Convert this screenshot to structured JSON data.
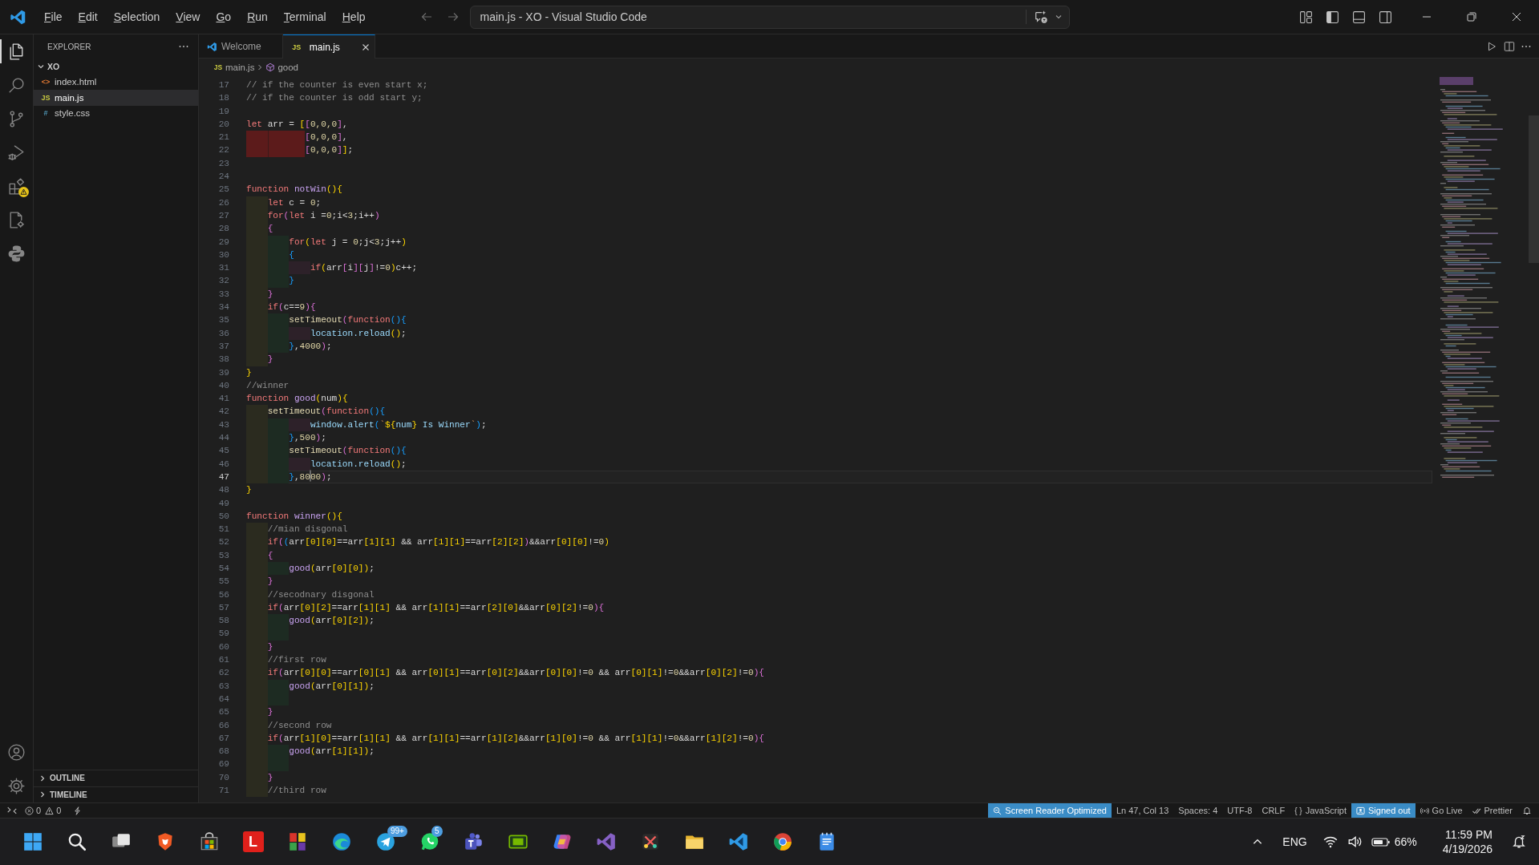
{
  "title_bar": {
    "menu": [
      "File",
      "Edit",
      "Selection",
      "View",
      "Go",
      "Run",
      "Terminal",
      "Help"
    ],
    "command_center": "main.js - XO - Visual Studio Code"
  },
  "activity_bar": {
    "items": [
      {
        "kind": "explorer",
        "selected": true,
        "warning": false
      },
      {
        "kind": "search",
        "selected": false,
        "warning": false
      },
      {
        "kind": "source-control",
        "selected": false,
        "warning": false
      },
      {
        "kind": "run-debug",
        "selected": false,
        "warning": false
      },
      {
        "kind": "extensions",
        "selected": false,
        "warning": true
      },
      {
        "kind": "doc-gear",
        "selected": false,
        "warning": false
      },
      {
        "kind": "snakes",
        "selected": false,
        "warning": false
      }
    ],
    "bottom_items": [
      {
        "kind": "account"
      },
      {
        "kind": "settings"
      }
    ]
  },
  "sidebar": {
    "title": "EXPLORER",
    "folder": {
      "name": "XO",
      "expanded": true,
      "children": [
        {
          "name": "index.html",
          "kind": "html",
          "icon": "<>",
          "selected": false
        },
        {
          "name": "main.js",
          "kind": "js",
          "icon": "JS",
          "selected": true
        },
        {
          "name": "style.css",
          "kind": "css",
          "icon": "#",
          "selected": false
        }
      ]
    },
    "sections": [
      {
        "title": "OUTLINE",
        "expanded": false
      },
      {
        "title": "TIMELINE",
        "expanded": false
      }
    ]
  },
  "tabs": [
    {
      "label": "Welcome",
      "kind": "welcome",
      "selected": false
    },
    {
      "label": "main.js",
      "kind": "js",
      "icon": "JS",
      "selected": true
    }
  ],
  "breadcrumb": [
    {
      "kind": "file",
      "icon": "JS",
      "label": "main.js"
    },
    {
      "kind": "symbol",
      "label": "good"
    }
  ],
  "editor": {
    "lines": [
      {
        "number": "17",
        "current": false,
        "indent_error": false,
        "tokens": [
          {
            "kind": "comment",
            "text": "// if the counter is even start x;"
          }
        ]
      },
      {
        "number": "18",
        "current": false,
        "indent_error": false,
        "tokens": [
          {
            "kind": "comment",
            "text": "// if the counter is odd start y;"
          }
        ]
      },
      {
        "number": "19",
        "current": false,
        "indent_error": false
      },
      {
        "number": "20",
        "current": false,
        "indent_error": false,
        "tokens": [
          {
            "kind": "keyword",
            "text": "let"
          },
          {
            "kind": "var",
            "text": " arr = "
          },
          {
            "kind": "b1",
            "text": "["
          },
          {
            "kind": "b2",
            "text": "["
          },
          {
            "kind": "num",
            "text": "0,0,0"
          },
          {
            "kind": "b2",
            "text": "]"
          },
          {
            "kind": "var",
            "text": ","
          }
        ]
      },
      {
        "number": "21",
        "current": false,
        "indent_error": true,
        "tokens": [
          {
            "kind": "b2",
            "text": "           ["
          },
          {
            "kind": "num",
            "text": "0,0,0"
          },
          {
            "kind": "b2",
            "text": "]"
          },
          {
            "kind": "var",
            "text": ","
          }
        ]
      },
      {
        "number": "22",
        "current": false,
        "indent_error": true,
        "tokens": [
          {
            "kind": "b2",
            "text": "           ["
          },
          {
            "kind": "num",
            "text": "0,0,0"
          },
          {
            "kind": "b2",
            "text": "]"
          },
          {
            "kind": "b1",
            "text": "]"
          },
          {
            "kind": "var",
            "text": ";"
          }
        ]
      },
      {
        "number": "23",
        "current": false,
        "indent_error": false
      },
      {
        "number": "24",
        "current": false,
        "indent_error": false
      },
      {
        "number": "25",
        "current": false,
        "indent_error": false,
        "tokens": [
          {
            "kind": "keyword",
            "text": "function"
          },
          {
            "kind": "name",
            "text": " notWin"
          },
          {
            "kind": "b1",
            "text": "(){"
          }
        ]
      },
      {
        "number": "26",
        "current": false,
        "indent_error": false,
        "tokens": [
          {
            "kind": "keyword",
            "text": "    let"
          },
          {
            "kind": "var",
            "text": " c = "
          },
          {
            "kind": "num",
            "text": "0"
          },
          {
            "kind": "var",
            "text": ";"
          }
        ]
      },
      {
        "number": "27",
        "current": false,
        "indent_error": false,
        "tokens": [
          {
            "kind": "keyword",
            "text": "    for"
          },
          {
            "kind": "b2",
            "text": "("
          },
          {
            "kind": "keyword",
            "text": "let"
          },
          {
            "kind": "var",
            "text": " i ="
          },
          {
            "kind": "num",
            "text": "0"
          },
          {
            "kind": "var",
            "text": ";i<"
          },
          {
            "kind": "num",
            "text": "3"
          },
          {
            "kind": "var",
            "text": ";i++"
          },
          {
            "kind": "b2",
            "text": ")"
          }
        ]
      },
      {
        "number": "28",
        "current": false,
        "indent_error": false,
        "tokens": [
          {
            "kind": "b2",
            "text": "    {"
          }
        ]
      },
      {
        "number": "29",
        "current": false,
        "indent_error": false,
        "tokens": [
          {
            "kind": "keyword",
            "text": "        for"
          },
          {
            "kind": "b1",
            "text": "("
          },
          {
            "kind": "keyword",
            "text": "let"
          },
          {
            "kind": "var",
            "text": " j = "
          },
          {
            "kind": "num",
            "text": "0"
          },
          {
            "kind": "var",
            "text": ";j<"
          },
          {
            "kind": "num",
            "text": "3"
          },
          {
            "kind": "var",
            "text": ";j++"
          },
          {
            "kind": "b1",
            "text": ")"
          }
        ]
      },
      {
        "number": "30",
        "current": false,
        "indent_error": false,
        "tokens": [
          {
            "kind": "b3",
            "text": "        {"
          }
        ]
      },
      {
        "number": "31",
        "current": false,
        "indent_error": false,
        "tokens": [
          {
            "kind": "keyword",
            "text": "            if"
          },
          {
            "kind": "b1",
            "text": "("
          },
          {
            "kind": "var",
            "text": "arr"
          },
          {
            "kind": "b2",
            "text": "["
          },
          {
            "kind": "var",
            "text": "i"
          },
          {
            "kind": "b2",
            "text": "]["
          },
          {
            "kind": "var",
            "text": "j"
          },
          {
            "kind": "b2",
            "text": "]"
          },
          {
            "kind": "var",
            "text": "!="
          },
          {
            "kind": "num",
            "text": "0"
          },
          {
            "kind": "b1",
            "text": ")"
          },
          {
            "kind": "var",
            "text": "c++;"
          }
        ]
      },
      {
        "number": "32",
        "current": false,
        "indent_error": false,
        "tokens": [
          {
            "kind": "b3",
            "text": "        }"
          }
        ]
      },
      {
        "number": "33",
        "current": false,
        "indent_error": false,
        "tokens": [
          {
            "kind": "b2",
            "text": "    }"
          }
        ]
      },
      {
        "number": "34",
        "current": false,
        "indent_error": false,
        "tokens": [
          {
            "kind": "keyword",
            "text": "    if"
          },
          {
            "kind": "b2",
            "text": "("
          },
          {
            "kind": "var",
            "text": "c=="
          },
          {
            "kind": "num",
            "text": "9"
          },
          {
            "kind": "b2",
            "text": "){"
          }
        ]
      },
      {
        "number": "35",
        "current": false,
        "indent_error": false,
        "tokens": [
          {
            "kind": "fn",
            "text": "        setTimeout"
          },
          {
            "kind": "b2",
            "text": "("
          },
          {
            "kind": "keyword",
            "text": "function"
          },
          {
            "kind": "b3",
            "text": "(){"
          }
        ]
      },
      {
        "number": "36",
        "current": false,
        "indent_error": false,
        "tokens": [
          {
            "kind": "prop",
            "text": "            location.reload"
          },
          {
            "kind": "b1",
            "text": "()"
          },
          {
            "kind": "var",
            "text": ";"
          }
        ]
      },
      {
        "number": "37",
        "current": false,
        "indent_error": false,
        "tokens": [
          {
            "kind": "b3",
            "text": "        }"
          },
          {
            "kind": "var",
            "text": ","
          },
          {
            "kind": "num",
            "text": "4000"
          },
          {
            "kind": "b2",
            "text": ")"
          },
          {
            "kind": "var",
            "text": ";"
          }
        ]
      },
      {
        "number": "38",
        "current": false,
        "indent_error": false,
        "tokens": [
          {
            "kind": "b2",
            "text": "    }"
          }
        ]
      },
      {
        "number": "39",
        "current": false,
        "indent_error": false,
        "tokens": [
          {
            "kind": "b1",
            "text": "}"
          }
        ]
      },
      {
        "number": "40",
        "current": false,
        "indent_error": false,
        "tokens": [
          {
            "kind": "comment",
            "text": "//winner"
          }
        ]
      },
      {
        "number": "41",
        "current": false,
        "indent_error": false,
        "tokens": [
          {
            "kind": "keyword",
            "text": "function"
          },
          {
            "kind": "name",
            "text": " good"
          },
          {
            "kind": "b1",
            "text": "("
          },
          {
            "kind": "var",
            "text": "num"
          },
          {
            "kind": "b1",
            "text": "){"
          }
        ]
      },
      {
        "number": "42",
        "current": false,
        "indent_error": false,
        "tokens": [
          {
            "kind": "fn",
            "text": "    setTimeout"
          },
          {
            "kind": "b2",
            "text": "("
          },
          {
            "kind": "keyword",
            "text": "function"
          },
          {
            "kind": "b3",
            "text": "(){"
          }
        ]
      },
      {
        "number": "43",
        "current": false,
        "indent_error": false,
        "tokens": [
          {
            "kind": "prop",
            "text": "            window.alert"
          },
          {
            "kind": "b3",
            "text": "("
          },
          {
            "kind": "str",
            "text": "`"
          },
          {
            "kind": "b1",
            "text": "${"
          },
          {
            "kind": "prop",
            "text": "num"
          },
          {
            "kind": "b1",
            "text": "}"
          },
          {
            "kind": "prop",
            "text": " Is Winner"
          },
          {
            "kind": "str",
            "text": "`"
          },
          {
            "kind": "b3",
            "text": ")"
          },
          {
            "kind": "var",
            "text": ";"
          }
        ]
      },
      {
        "number": "44",
        "current": false,
        "indent_error": false,
        "tokens": [
          {
            "kind": "b3",
            "text": "        }"
          },
          {
            "kind": "var",
            "text": ","
          },
          {
            "kind": "num",
            "text": "500"
          },
          {
            "kind": "b2",
            "text": ")"
          },
          {
            "kind": "var",
            "text": ";"
          }
        ]
      },
      {
        "number": "45",
        "current": false,
        "indent_error": false,
        "tokens": [
          {
            "kind": "fn",
            "text": "        setTimeout"
          },
          {
            "kind": "b2",
            "text": "("
          },
          {
            "kind": "keyword",
            "text": "function"
          },
          {
            "kind": "b3",
            "text": "(){"
          }
        ]
      },
      {
        "number": "46",
        "current": false,
        "indent_error": false,
        "tokens": [
          {
            "kind": "prop",
            "text": "            location.reload"
          },
          {
            "kind": "b1",
            "text": "()"
          },
          {
            "kind": "var",
            "text": ";"
          }
        ]
      },
      {
        "number": "47",
        "current": true,
        "indent_error": false,
        "tokens": [
          {
            "kind": "b3",
            "text": "        }"
          },
          {
            "kind": "var",
            "text": ","
          },
          {
            "kind": "num",
            "text": "80"
          },
          {
            "kind": "cursor"
          },
          {
            "kind": "num",
            "text": "00"
          },
          {
            "kind": "b2",
            "text": ")"
          },
          {
            "kind": "var",
            "text": ";"
          }
        ]
      },
      {
        "number": "48",
        "current": false,
        "indent_error": false,
        "tokens": [
          {
            "kind": "b1",
            "text": "}"
          }
        ]
      },
      {
        "number": "49",
        "current": false,
        "indent_error": false
      },
      {
        "number": "50",
        "current": false,
        "indent_error": false,
        "tokens": [
          {
            "kind": "keyword",
            "text": "function"
          },
          {
            "kind": "name",
            "text": " winner"
          },
          {
            "kind": "b1",
            "text": "(){"
          }
        ]
      },
      {
        "number": "51",
        "current": false,
        "indent_error": false,
        "tokens": [
          {
            "kind": "comment",
            "text": "    //mian disgonal"
          }
        ]
      },
      {
        "number": "52",
        "current": false,
        "indent_error": false,
        "tokens": [
          {
            "kind": "keyword",
            "text": "    if"
          },
          {
            "kind": "b2",
            "text": "("
          },
          {
            "kind": "b3",
            "text": "("
          },
          {
            "kind": "var",
            "text": "arr"
          },
          {
            "kind": "b1",
            "text": "[0][0]"
          },
          {
            "kind": "var",
            "text": "==arr"
          },
          {
            "kind": "b1",
            "text": "[1][1]"
          },
          {
            "kind": "var",
            "text": " && arr"
          },
          {
            "kind": "b1",
            "text": "[1][1]"
          },
          {
            "kind": "var",
            "text": "==arr"
          },
          {
            "kind": "b1",
            "text": "[2][2]"
          },
          {
            "kind": "b2",
            "text": ")"
          },
          {
            "kind": "var",
            "text": "&&arr"
          },
          {
            "kind": "b1",
            "text": "[0][0]"
          },
          {
            "kind": "var",
            "text": "!="
          },
          {
            "kind": "num",
            "text": "0"
          },
          {
            "kind": "b1",
            "text": ")"
          }
        ]
      },
      {
        "number": "53",
        "current": false,
        "indent_error": false,
        "tokens": [
          {
            "kind": "b2",
            "text": "    {"
          }
        ]
      },
      {
        "number": "54",
        "current": false,
        "indent_error": false,
        "tokens": [
          {
            "kind": "call",
            "text": "        good"
          },
          {
            "kind": "b1",
            "text": "("
          },
          {
            "kind": "var",
            "text": "arr"
          },
          {
            "kind": "b1",
            "text": "[0][0]"
          },
          {
            "kind": "b1",
            "text": ")"
          },
          {
            "kind": "var",
            "text": ";"
          }
        ]
      },
      {
        "number": "55",
        "current": false,
        "indent_error": false,
        "tokens": [
          {
            "kind": "b2",
            "text": "    }"
          }
        ]
      },
      {
        "number": "56",
        "current": false,
        "indent_error": false,
        "tokens": [
          {
            "kind": "comment",
            "text": "    //secodnary disgonal"
          }
        ]
      },
      {
        "number": "57",
        "current": false,
        "indent_error": false,
        "tokens": [
          {
            "kind": "keyword",
            "text": "    if"
          },
          {
            "kind": "b2",
            "text": "("
          },
          {
            "kind": "var",
            "text": "arr"
          },
          {
            "kind": "b1",
            "text": "[0][2]"
          },
          {
            "kind": "var",
            "text": "==arr"
          },
          {
            "kind": "b1",
            "text": "[1][1]"
          },
          {
            "kind": "var",
            "text": " && arr"
          },
          {
            "kind": "b1",
            "text": "[1][1]"
          },
          {
            "kind": "var",
            "text": "==arr"
          },
          {
            "kind": "b1",
            "text": "[2][0]"
          },
          {
            "kind": "var",
            "text": "&&arr"
          },
          {
            "kind": "b1",
            "text": "[0][2]"
          },
          {
            "kind": "var",
            "text": "!="
          },
          {
            "kind": "num",
            "text": "0"
          },
          {
            "kind": "b2",
            "text": "){"
          }
        ]
      },
      {
        "number": "58",
        "current": false,
        "indent_error": false,
        "tokens": [
          {
            "kind": "call",
            "text": "        good"
          },
          {
            "kind": "b1",
            "text": "("
          },
          {
            "kind": "var",
            "text": "arr"
          },
          {
            "kind": "b1",
            "text": "[0][2]"
          },
          {
            "kind": "b1",
            "text": ")"
          },
          {
            "kind": "var",
            "text": ";"
          }
        ]
      },
      {
        "number": "59",
        "current": false,
        "indent_error": false
      },
      {
        "number": "60",
        "current": false,
        "indent_error": false,
        "tokens": [
          {
            "kind": "b2",
            "text": "    }"
          }
        ]
      },
      {
        "number": "61",
        "current": false,
        "indent_error": false,
        "tokens": [
          {
            "kind": "comment",
            "text": "    //first row"
          }
        ]
      },
      {
        "number": "62",
        "current": false,
        "indent_error": false,
        "tokens": [
          {
            "kind": "keyword",
            "text": "    if"
          },
          {
            "kind": "b2",
            "text": "("
          },
          {
            "kind": "var",
            "text": "arr"
          },
          {
            "kind": "b1",
            "text": "[0][0]"
          },
          {
            "kind": "var",
            "text": "==arr"
          },
          {
            "kind": "b1",
            "text": "[0][1]"
          },
          {
            "kind": "var",
            "text": " && arr"
          },
          {
            "kind": "b1",
            "text": "[0][1]"
          },
          {
            "kind": "var",
            "text": "==arr"
          },
          {
            "kind": "b1",
            "text": "[0][2]"
          },
          {
            "kind": "var",
            "text": "&&arr"
          },
          {
            "kind": "b1",
            "text": "[0][0]"
          },
          {
            "kind": "var",
            "text": "!="
          },
          {
            "kind": "num",
            "text": "0"
          },
          {
            "kind": "var",
            "text": " && arr"
          },
          {
            "kind": "b1",
            "text": "[0][1]"
          },
          {
            "kind": "var",
            "text": "!="
          },
          {
            "kind": "num",
            "text": "0"
          },
          {
            "kind": "var",
            "text": "&&arr"
          },
          {
            "kind": "b1",
            "text": "[0][2]"
          },
          {
            "kind": "var",
            "text": "!="
          },
          {
            "kind": "num",
            "text": "0"
          },
          {
            "kind": "b2",
            "text": "){"
          }
        ]
      },
      {
        "number": "63",
        "current": false,
        "indent_error": false,
        "tokens": [
          {
            "kind": "call",
            "text": "        good"
          },
          {
            "kind": "b1",
            "text": "("
          },
          {
            "kind": "var",
            "text": "arr"
          },
          {
            "kind": "b1",
            "text": "[0][1]"
          },
          {
            "kind": "b1",
            "text": ")"
          },
          {
            "kind": "var",
            "text": ";"
          }
        ]
      },
      {
        "number": "64",
        "current": false,
        "indent_error": false
      },
      {
        "number": "65",
        "current": false,
        "indent_error": false,
        "tokens": [
          {
            "kind": "b2",
            "text": "    }"
          }
        ]
      },
      {
        "number": "66",
        "current": false,
        "indent_error": false,
        "tokens": [
          {
            "kind": "comment",
            "text": "    //second row"
          }
        ]
      },
      {
        "number": "67",
        "current": false,
        "indent_error": false,
        "tokens": [
          {
            "kind": "keyword",
            "text": "    if"
          },
          {
            "kind": "b2",
            "text": "("
          },
          {
            "kind": "var",
            "text": "arr"
          },
          {
            "kind": "b1",
            "text": "[1][0]"
          },
          {
            "kind": "var",
            "text": "==arr"
          },
          {
            "kind": "b1",
            "text": "[1][1]"
          },
          {
            "kind": "var",
            "text": " && arr"
          },
          {
            "kind": "b1",
            "text": "[1][1]"
          },
          {
            "kind": "var",
            "text": "==arr"
          },
          {
            "kind": "b1",
            "text": "[1][2]"
          },
          {
            "kind": "var",
            "text": "&&arr"
          },
          {
            "kind": "b1",
            "text": "[1][0]"
          },
          {
            "kind": "var",
            "text": "!="
          },
          {
            "kind": "num",
            "text": "0"
          },
          {
            "kind": "var",
            "text": " && arr"
          },
          {
            "kind": "b1",
            "text": "[1][1]"
          },
          {
            "kind": "var",
            "text": "!="
          },
          {
            "kind": "num",
            "text": "0"
          },
          {
            "kind": "var",
            "text": "&&arr"
          },
          {
            "kind": "b1",
            "text": "[1][2]"
          },
          {
            "kind": "var",
            "text": "!="
          },
          {
            "kind": "num",
            "text": "0"
          },
          {
            "kind": "b2",
            "text": "){"
          }
        ]
      },
      {
        "number": "68",
        "current": false,
        "indent_error": false,
        "tokens": [
          {
            "kind": "call",
            "text": "        good"
          },
          {
            "kind": "b1",
            "text": "("
          },
          {
            "kind": "var",
            "text": "arr"
          },
          {
            "kind": "b1",
            "text": "[1][1]"
          },
          {
            "kind": "b1",
            "text": ")"
          },
          {
            "kind": "var",
            "text": ";"
          }
        ]
      },
      {
        "number": "69",
        "current": false,
        "indent_error": false
      },
      {
        "number": "70",
        "current": false,
        "indent_error": false,
        "tokens": [
          {
            "kind": "b2",
            "text": "    }"
          }
        ]
      },
      {
        "number": "71",
        "current": false,
        "indent_error": false,
        "tokens": [
          {
            "kind": "comment",
            "text": "    //third row"
          }
        ]
      }
    ]
  },
  "status_bar": {
    "errors": "0",
    "warnings": "0",
    "items": [
      {
        "kind": "screen-reader",
        "label": "Screen Reader Optimized",
        "highlighted": true
      },
      {
        "kind": "text",
        "label": "Ln 47, Col 13",
        "highlighted": false
      },
      {
        "kind": "text",
        "label": "Spaces: 4",
        "highlighted": false
      },
      {
        "kind": "text",
        "label": "UTF-8",
        "highlighted": false
      },
      {
        "kind": "text",
        "label": "CRLF",
        "highlighted": false
      },
      {
        "kind": "language",
        "icon": "{ }",
        "label": "JavaScript",
        "highlighted": false
      },
      {
        "kind": "account",
        "label": "Signed out",
        "highlighted": true
      },
      {
        "kind": "live",
        "label": "Go Live",
        "highlighted": false
      },
      {
        "kind": "prettier",
        "label": "Prettier",
        "highlighted": false
      },
      {
        "kind": "bell",
        "highlighted": false
      }
    ]
  },
  "taskbar": {
    "apps": [
      {
        "kind": "start"
      },
      {
        "kind": "search"
      },
      {
        "kind": "task-view"
      },
      {
        "kind": "shield"
      },
      {
        "kind": "store"
      },
      {
        "kind": "letter",
        "label": "L"
      },
      {
        "kind": "blocks"
      },
      {
        "kind": "wave"
      },
      {
        "kind": "plane",
        "badge": "99+"
      },
      {
        "kind": "phone",
        "badge": "5"
      },
      {
        "kind": "people"
      },
      {
        "kind": "chip"
      },
      {
        "kind": "swirl"
      },
      {
        "kind": "ribbon"
      },
      {
        "kind": "scissors"
      },
      {
        "kind": "folder"
      },
      {
        "kind": "code"
      },
      {
        "kind": "circle"
      },
      {
        "kind": "notepad"
      }
    ],
    "tray": {
      "language": "ENG",
      "battery": "66%",
      "time": "11:59 PM",
      "date": "4/19/2026"
    }
  }
}
